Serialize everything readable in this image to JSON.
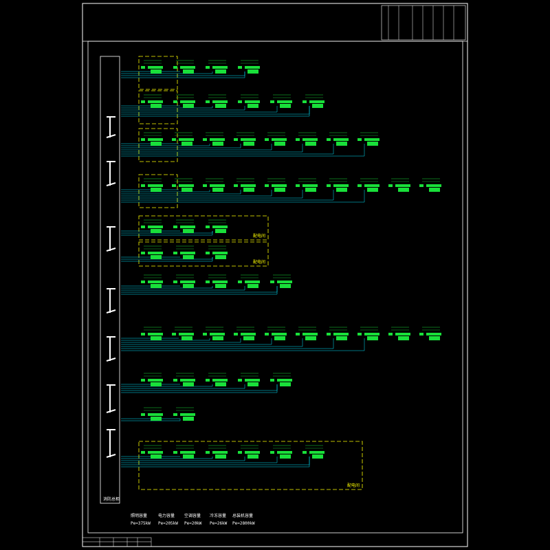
{
  "title_block": {
    "vertical_text": "",
    "cells": [
      "",
      "",
      "",
      "",
      "",
      "",
      ""
    ]
  },
  "left_column_label": "",
  "sections": [
    {
      "header": "",
      "boxes": 4,
      "dashed_group": true
    },
    {
      "header": "",
      "boxes": 6,
      "dashed_group": true
    },
    {
      "header": "",
      "boxes": 8,
      "dashed_group": true
    },
    {
      "header": "",
      "boxes": 10,
      "dashed_group": true
    },
    {
      "header": "",
      "boxes": 3,
      "dashed_group": true,
      "group_label": "配电间"
    },
    {
      "header": "",
      "boxes": 3,
      "dashed_group": true,
      "group_label": "配电间"
    },
    {
      "header": "",
      "boxes": 5,
      "dashed_group": false
    },
    {
      "header": "",
      "boxes": 10,
      "dashed_group": false
    },
    {
      "header": "",
      "boxes": 5,
      "dashed_group": false
    },
    {
      "header": "",
      "boxes": 2,
      "dashed_group": false
    },
    {
      "header": "",
      "boxes": 6,
      "dashed_group": true,
      "group_label": "配电间"
    }
  ],
  "bottom_left_label": "消防总柜",
  "summary": [
    {
      "name": "照明容量",
      "value": "Pe=375kW"
    },
    {
      "name": "电力容量",
      "value": "Pe=205kW"
    },
    {
      "name": "空调容量",
      "value": "Pe=20kW"
    },
    {
      "name": "冷冻容量",
      "value": "Pe=26kW"
    },
    {
      "name": "总装机容量",
      "value": "Pe=2800kW"
    }
  ],
  "colors": {
    "frame": "#ffffff",
    "box": "#19e03a",
    "wire": "#00e5ff",
    "dashed": "#ffff00",
    "text": "#ffffff"
  }
}
